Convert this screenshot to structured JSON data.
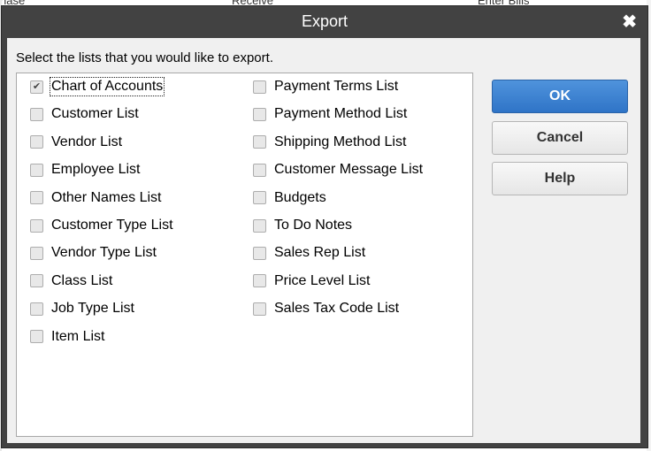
{
  "background": {
    "text_left": "hase",
    "text_mid": "Receive",
    "text_right": "Enter Bills"
  },
  "dialog": {
    "title": "Export",
    "close_glyph": "✖",
    "instruction": "Select the lists that you would like to export.",
    "lists_left": [
      {
        "label": "Chart of Accounts",
        "checked": true
      },
      {
        "label": "Customer List",
        "checked": false
      },
      {
        "label": "Vendor List",
        "checked": false
      },
      {
        "label": "Employee List",
        "checked": false
      },
      {
        "label": "Other Names List",
        "checked": false
      },
      {
        "label": "Customer Type List",
        "checked": false
      },
      {
        "label": "Vendor Type List",
        "checked": false
      },
      {
        "label": "Class List",
        "checked": false
      },
      {
        "label": "Job Type List",
        "checked": false
      },
      {
        "label": "Item List",
        "checked": false
      }
    ],
    "lists_right": [
      {
        "label": "Payment Terms List",
        "checked": false
      },
      {
        "label": "Payment Method List",
        "checked": false
      },
      {
        "label": "Shipping Method List",
        "checked": false
      },
      {
        "label": "Customer Message List",
        "checked": false
      },
      {
        "label": "Budgets",
        "checked": false
      },
      {
        "label": "To Do Notes",
        "checked": false
      },
      {
        "label": "Sales Rep List",
        "checked": false
      },
      {
        "label": "Price Level List",
        "checked": false
      },
      {
        "label": "Sales Tax Code List",
        "checked": false
      }
    ],
    "buttons": {
      "ok": "OK",
      "cancel": "Cancel",
      "help": "Help"
    }
  },
  "colors": {
    "titlebar": "#424242",
    "ok_button": "#3a7fd0"
  }
}
